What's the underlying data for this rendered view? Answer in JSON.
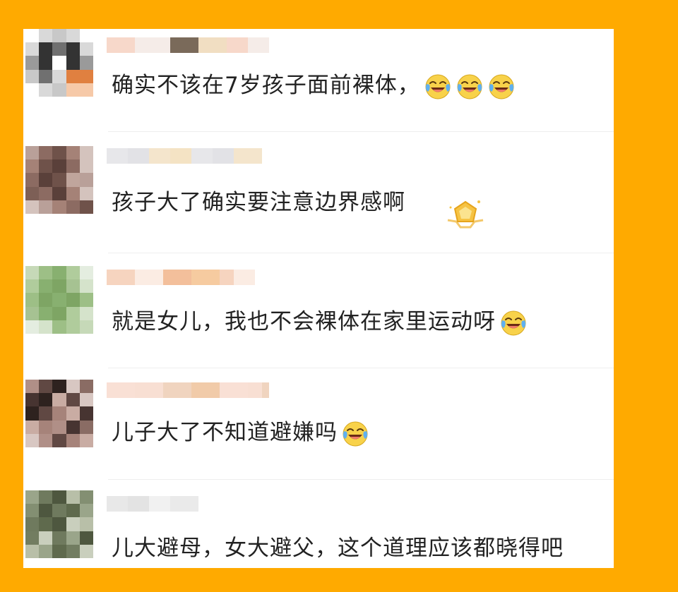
{
  "comments": [
    {
      "text": "确实不该在7岁孩子面前裸体，",
      "emoji": [
        "laughing-crying-emoji",
        "laughing-crying-emoji",
        "laughing-crying-emoji"
      ],
      "avatar_palette": [
        "#ffffff",
        "#d9d9d9",
        "#c8c8c8",
        "#333333",
        "#707070",
        "#9a9a9a",
        "#e08040",
        "#f6c9a8"
      ],
      "name_palette": [
        "#f6d4c4",
        "#efe0d8",
        "#6b5a48",
        "#e8c89a"
      ]
    },
    {
      "text": "孩子大了确实要注意边界感啊",
      "emoji": [
        "gold-star-badge"
      ],
      "avatar_palette": [
        "#b9a099",
        "#8c6b62",
        "#6f524a",
        "#a58277",
        "#d4c3bd",
        "#5a403a",
        "#c0a59c",
        "#7d5f56"
      ],
      "name_palette": [
        "#e4e4e8",
        "#cfcfd6",
        "#f3e2c6",
        "#ecd19c"
      ]
    },
    {
      "text": "就是女儿，我也不会裸体在家里运动呀",
      "emoji": [
        "laughing-crying-emoji"
      ],
      "avatar_palette": [
        "#c6d9b8",
        "#9dbf86",
        "#88b070",
        "#b0cc9c",
        "#e4ede0",
        "#a6c292",
        "#7ea564",
        "#d5e3cb"
      ],
      "name_palette": [
        "#f5cfb8",
        "#f8e0d0",
        "#f2b890",
        "#f0a860"
      ]
    },
    {
      "text": "儿子大了不知道避嫌吗",
      "emoji": [
        "laughing-crying-emoji"
      ],
      "avatar_palette": [
        "#b08f87",
        "#604843",
        "#2e221f",
        "#d8c7c2",
        "#8a6c64",
        "#c9aca3",
        "#473431",
        "#a6837a"
      ],
      "name_palette": [
        "#f8ddd0",
        "#f3cab5",
        "#eecfb8",
        "#e8a870"
      ]
    },
    {
      "text": "儿大避母，女大避父，这个道理应该都晓得吧",
      "emoji": [],
      "avatar_palette": [
        "#9aa58a",
        "#6f7a5e",
        "#4e573f",
        "#b8bfa8",
        "#838f72",
        "#5f6a4d",
        "#c9cfbd",
        "#727d61"
      ],
      "name_palette": [
        "#e6e6e6",
        "#d0d0d0",
        "#f0f0f0",
        "#dcdcdc"
      ]
    }
  ],
  "colors": {
    "page_background": "#FFAA00",
    "card_background": "#FFFFFF",
    "text": "#222222"
  }
}
